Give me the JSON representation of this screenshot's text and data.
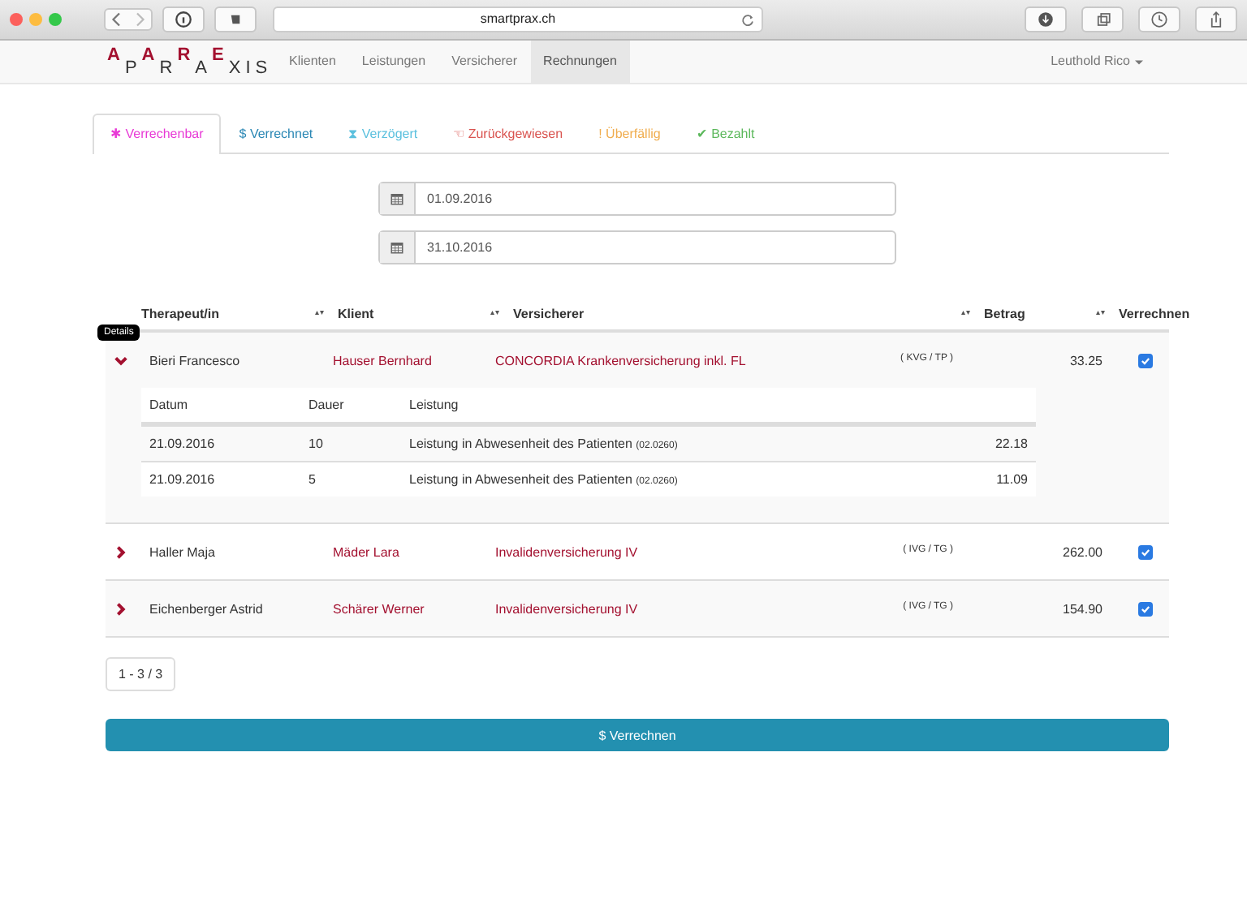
{
  "browser": {
    "address": "smartprax.ch"
  },
  "logo": [
    {
      "ch": "A",
      "raised": true
    },
    {
      "ch": "P",
      "raised": false
    },
    {
      "ch": "A",
      "raised": true
    },
    {
      "ch": "R",
      "raised": false
    },
    {
      "ch": "R",
      "raised": true
    },
    {
      "ch": "A",
      "raised": false
    },
    {
      "ch": "E",
      "raised": true
    },
    {
      "ch": "X",
      "raised": false
    },
    {
      "ch": "I",
      "raised": false
    },
    {
      "ch": "S",
      "raised": false
    }
  ],
  "nav": [
    {
      "label": "Klienten",
      "selected": false
    },
    {
      "label": "Leistungen",
      "selected": false
    },
    {
      "label": "Versicherer",
      "selected": false
    },
    {
      "label": "Rechnungen",
      "selected": true
    }
  ],
  "user": "Leuthold Rico",
  "tabs": [
    {
      "icon": "✱",
      "label": "Verrechenbar",
      "color": "#e83ad6",
      "selected": true
    },
    {
      "icon": "$",
      "label": "Verrechnet",
      "color": "#2a87b4",
      "selected": false
    },
    {
      "icon": "⧗",
      "label": "Verzögert",
      "color": "#5bc0de",
      "selected": false
    },
    {
      "icon": "☜",
      "label": "Zurückgewiesen",
      "color": "#d9534f",
      "selected": false
    },
    {
      "icon": "!",
      "label": "Überfällig",
      "color": "#f0ad4e",
      "selected": false
    },
    {
      "icon": "✔",
      "label": "Bezahlt",
      "color": "#5cb85c",
      "selected": false
    }
  ],
  "date_from": "01.09.2016",
  "date_to": "31.10.2016",
  "table": {
    "columns": [
      {
        "label": "Therapeut/in",
        "sortable": true
      },
      {
        "label": "Klient",
        "sortable": true
      },
      {
        "label": "Versicherer",
        "sortable": true
      },
      {
        "label": "Betrag",
        "sortable": true
      },
      {
        "label": "Verrechnen",
        "sortable": false
      }
    ],
    "sort_icon": "▴▾",
    "tooltip": "Details",
    "rows": [
      {
        "therapist": "Bieri Francesco",
        "client": "Hauser Bernhard",
        "insurer": "CONCORDIA Krankenversicherung inkl. FL",
        "law": "( KVG / TP )",
        "amount": "33.25",
        "checked": true,
        "expanded": true,
        "details": {
          "columns": [
            "Datum",
            "Dauer",
            "Leistung"
          ],
          "rows": [
            {
              "date": "21.09.2016",
              "duration": "10",
              "service": "Leistung in Abwesenheit des Patienten",
              "code": "(02.0260)",
              "amount": "22.18"
            },
            {
              "date": "21.09.2016",
              "duration": "5",
              "service": "Leistung in Abwesenheit des Patienten",
              "code": "(02.0260)",
              "amount": "11.09"
            }
          ]
        }
      },
      {
        "therapist": "Haller Maja",
        "client": "Mäder Lara",
        "insurer": "Invalidenversicherung IV",
        "law": "( IVG / TG )",
        "amount": "262.00",
        "checked": true,
        "expanded": false
      },
      {
        "therapist": "Eichenberger Astrid",
        "client": "Schärer Werner",
        "insurer": "Invalidenversicherung IV",
        "law": "( IVG / TG )",
        "amount": "154.90",
        "checked": true,
        "expanded": false
      }
    ]
  },
  "pagination": "1 - 3 / 3",
  "submit": "$ Verrechnen"
}
